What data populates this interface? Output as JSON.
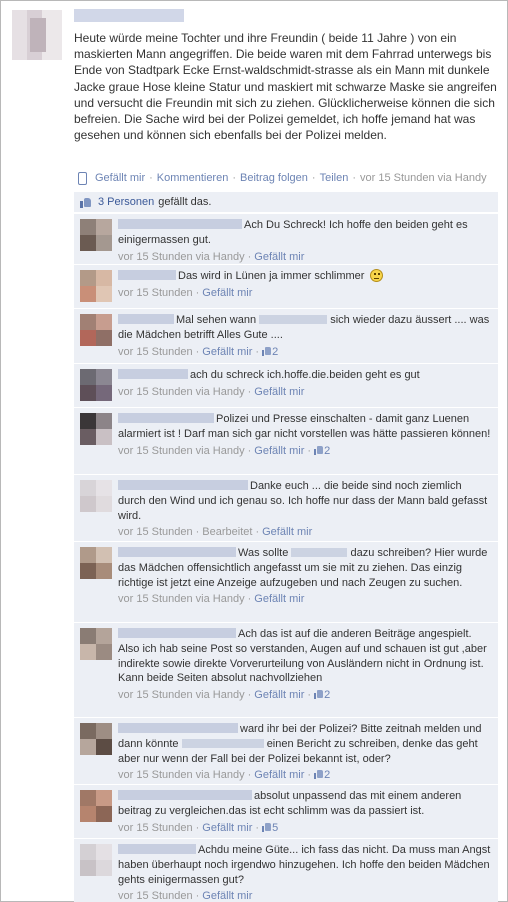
{
  "post": {
    "text": "Heute würde meine Tochter und ihre Freundin ( beide 11 Jahre ) von ein maskierten Mann angegriffen. Die beide waren mit dem Fahrrad unterwegs bis Ende von Stadtpark Ecke Ernst-waldschmidt-strasse als ein Mann mit dunkele Jacke graue Hose kleine Statur und maskiert mit schwarze Maske sie angreifen und versucht die Freundin mit sich zu ziehen. Glücklicherweise können die sich befreien. Die Sache wird bei der Polizei gemeldet, ich hoffe jemand hat was gesehen und können sich ebenfalls bei der Polizei melden.",
    "actions": {
      "like": "Gefällt mir",
      "comment": "Kommentieren",
      "follow": "Beitrag folgen",
      "share": "Teilen",
      "time": "vor 15 Stunden via Handy",
      "sep": "·"
    },
    "likes": {
      "people": "3 Personen",
      "suffix": "gefällt das."
    }
  },
  "comments": [
    {
      "text": "Ach Du Schreck! Ich hoffe den beiden geht es einigermassen gut.",
      "time": "vor 15 Stunden via Handy",
      "like": "Gefällt mir",
      "likes": ""
    },
    {
      "text": "Das wird in Lünen ja immer schlimmer",
      "time": "vor 15 Stunden",
      "like": "Gefällt mir",
      "likes": ""
    },
    {
      "text_a": "Mal sehen wann",
      "text_b": "sich wieder dazu äussert .... was die Mädchen betrifft Alles Gute ....",
      "time": "vor 15 Stunden",
      "like": "Gefällt mir",
      "likes": "2"
    },
    {
      "text": "ach du schreck ich.hoffe.die.beiden geht es gut",
      "time": "vor 15 Stunden via Handy",
      "like": "Gefällt mir",
      "likes": ""
    },
    {
      "text": "Polizei und Presse einschalten - damit ganz Luenen alarmiert ist ! Darf man sich gar nicht vorstellen was hätte passieren können!",
      "time": "vor 15 Stunden via Handy",
      "like": "Gefällt mir",
      "likes": "2"
    },
    {
      "text": "Danke euch ... die beide sind noch ziemlich durch den Wind und ich genau so. Ich hoffe nur dass der Mann bald gefasst wird.",
      "time": "vor 15 Stunden",
      "edited": "Bearbeitet",
      "like": "Gefällt mir",
      "likes": ""
    },
    {
      "text_a": "Was sollte",
      "text_b": "dazu schreiben? Hier wurde das Mädchen offensichtlich angefasst um sie mit zu ziehen. Das einzig richtige ist jetzt eine Anzeige aufzugeben und nach Zeugen zu suchen.",
      "time": "vor 15 Stunden via Handy",
      "like": "Gefällt mir",
      "likes": ""
    },
    {
      "text": "Ach das ist auf die anderen Beiträge angespielt. Also ich hab seine Post so verstanden, Augen auf und schauen ist gut ,aber indirekte sowie direkte Vorverurteilung von Ausländern nicht in Ordnung ist. Kann beide Seiten absolut nachvollziehen",
      "time": "vor 15 Stunden via Handy",
      "like": "Gefällt mir",
      "likes": "2"
    },
    {
      "text_a": "ward ihr bei der Polizei? Bitte zeitnah melden und dann könnte",
      "text_b": "einen Bericht zu schreiben, denke das geht aber nur wenn der Fall bei der Polizei bekannt ist, oder?",
      "time": "vor 15 Stunden via Handy",
      "like": "Gefällt mir",
      "likes": "2"
    },
    {
      "text": "absolut unpassend das mit einem anderen beitrag zu vergleichen.das ist echt schlimm was da passiert ist.",
      "time": "vor 15 Stunden",
      "like": "Gefällt mir",
      "likes": "5"
    },
    {
      "text": "Achdu meine Güte... ich fass das nicht. Da muss man Angst haben überhaupt noch irgendwo hinzugehen. Ich hoffe den beiden Mädchen gehts einigermassen gut?",
      "time": "vor 15 Stunden",
      "like": "Gefällt mir",
      "likes": ""
    }
  ],
  "colors": {
    "link": "#6d84b4",
    "comment_bg": "#eceff5",
    "text": "#333333",
    "meta": "#999999"
  },
  "icons": [
    "phone-icon",
    "thumbs-up-icon",
    "smiley-icon"
  ]
}
